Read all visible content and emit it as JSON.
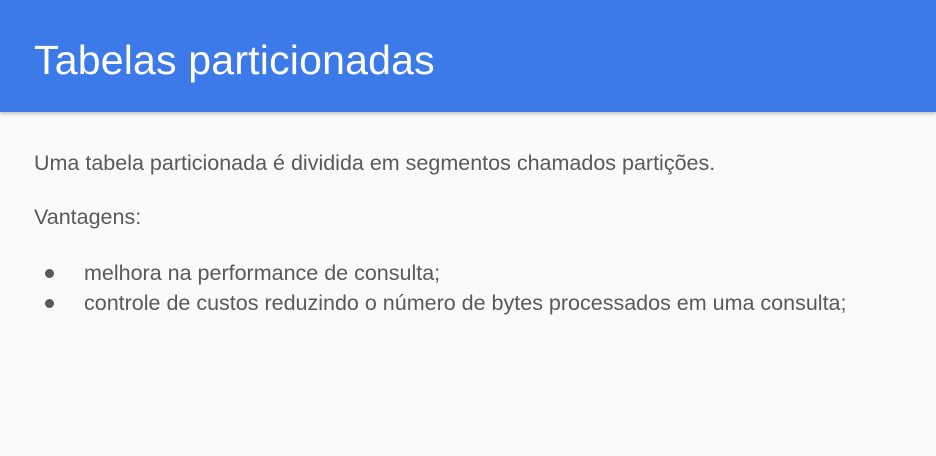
{
  "slide": {
    "title": "Tabelas particionadas",
    "intro": "Uma tabela particionada é dividida em segmentos chamados partições.",
    "subhead": "Vantagens:",
    "bullets": [
      "melhora na performance de consulta;",
      "controle de custos reduzindo o número de bytes processados em uma consulta;"
    ]
  },
  "colors": {
    "header_background": "#3b7ae8",
    "title_text": "#ffffff",
    "body_text": "#595959",
    "page_background": "#fafafa"
  }
}
